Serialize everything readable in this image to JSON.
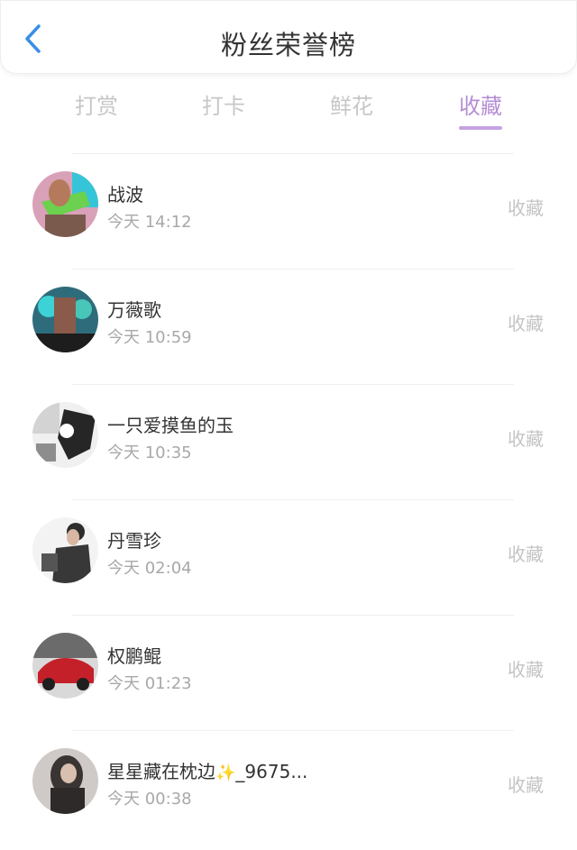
{
  "header": {
    "title": "粉丝荣誉榜",
    "back_icon": "chevron-left-icon",
    "accent_color": "#3a8ee6"
  },
  "tabs": [
    {
      "label": "打赏",
      "active": false
    },
    {
      "label": "打卡",
      "active": false
    },
    {
      "label": "鲜花",
      "active": false
    },
    {
      "label": "收藏",
      "active": true
    }
  ],
  "colors": {
    "active_tab": "#b48ed6",
    "inactive_tab": "#c7c7c7",
    "underline": "#c4a2e3"
  },
  "rows": [
    {
      "name": "战波",
      "time": "今天 14:12",
      "action": "收藏"
    },
    {
      "name": "万薇歌",
      "time": "今天 10:59",
      "action": "收藏"
    },
    {
      "name": "一只爱摸鱼的玉",
      "time": "今天 10:35",
      "action": "收藏"
    },
    {
      "name": "丹雪珍",
      "time": "今天 02:04",
      "action": "收藏"
    },
    {
      "name": "权鹏鲲",
      "time": "今天 01:23",
      "action": "收藏"
    },
    {
      "name": "星星藏在枕边",
      "name_suffix": "_9675...",
      "time": "今天 00:38",
      "action": "收藏",
      "emoji": "sparkles-icon"
    }
  ]
}
